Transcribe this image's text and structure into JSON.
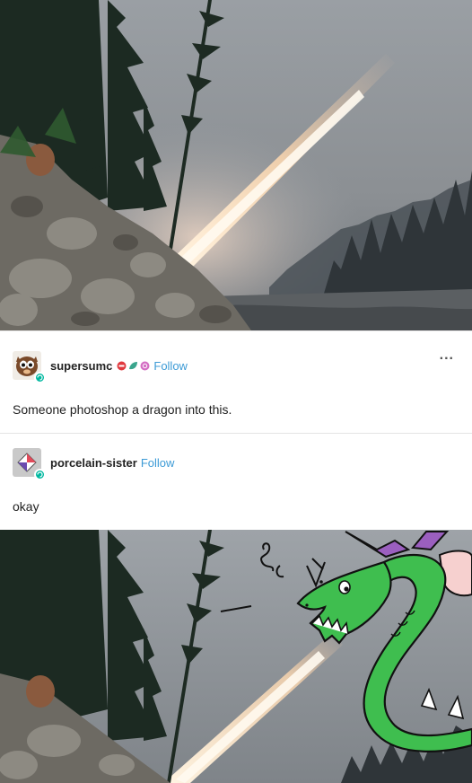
{
  "posts": [
    {
      "username": "supersumc",
      "follow_label": "Follow",
      "body": "Someone photoshop a dragon into this.",
      "more_label": "..."
    },
    {
      "username": "porcelain-sister",
      "follow_label": "Follow",
      "body": "okay"
    }
  ],
  "colors": {
    "follow_link": "#3d9bd6",
    "verified_badge": "#00b8a0",
    "dragon_green": "#3fbe4f"
  },
  "icons": [
    "more-icon",
    "avatar-badge-icon",
    "blog-badge-icons"
  ]
}
